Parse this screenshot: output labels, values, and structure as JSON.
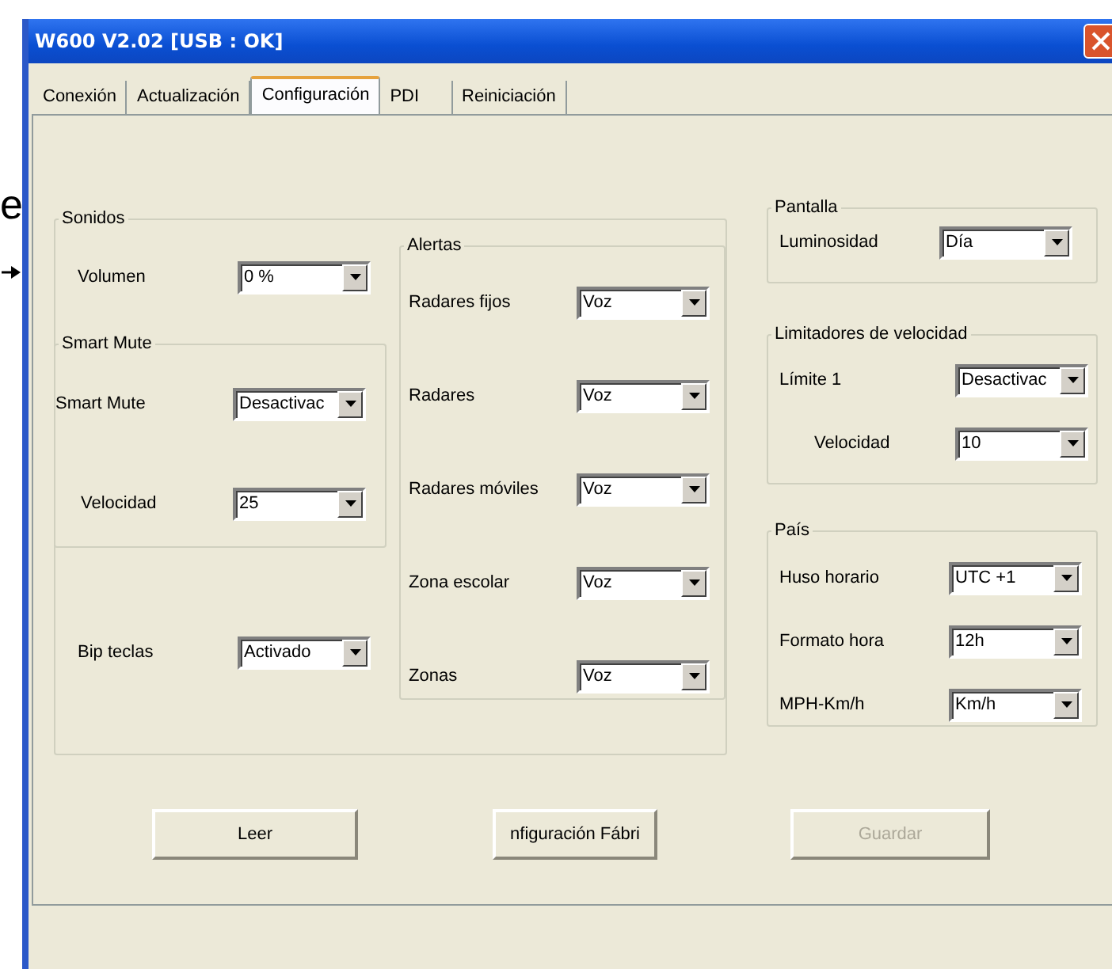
{
  "backdrop": {
    "text": "e"
  },
  "window": {
    "title": "W600 V2.02 [USB : OK]"
  },
  "tabs": [
    {
      "label": "Conexión",
      "selected": false
    },
    {
      "label": "Actualización",
      "selected": false
    },
    {
      "label": "Configuración",
      "selected": true
    },
    {
      "label": "PDI",
      "selected": false
    },
    {
      "label": "Reiniciación",
      "selected": false
    }
  ],
  "sonidos": {
    "title": "Sonidos",
    "volumen": {
      "label": "Volumen",
      "value": "0 %"
    },
    "smart_mute": {
      "title": "Smart Mute",
      "rows": [
        {
          "label": "Smart Mute",
          "value": "Desactivac",
          "indented": false
        },
        {
          "label": "Velocidad",
          "value": "25",
          "indented": true
        }
      ]
    },
    "bip": {
      "label": "Bip teclas",
      "value": "Activado"
    },
    "alertas": {
      "title": "Alertas",
      "rows": [
        {
          "label": "Radares fijos",
          "value": "Voz"
        },
        {
          "label": "Radares",
          "value": "Voz"
        },
        {
          "label": "Radares móviles",
          "value": "Voz"
        },
        {
          "label": "Zona escolar",
          "value": "Voz"
        },
        {
          "label": "Zonas",
          "value": "Voz"
        }
      ]
    }
  },
  "pantalla": {
    "title": "Pantalla",
    "rows": [
      {
        "label": "Luminosidad",
        "value": "Día"
      }
    ]
  },
  "limitadores": {
    "title": "Limitadores de velocidad",
    "rows": [
      {
        "label": "Límite 1",
        "value": "Desactivac",
        "indented": false
      },
      {
        "label": "Velocidad",
        "value": "10",
        "indented": true
      }
    ]
  },
  "pais": {
    "title": "País",
    "rows": [
      {
        "label": "Huso horario",
        "value": "UTC +1"
      },
      {
        "label": "Formato hora",
        "value": "12h"
      },
      {
        "label": "MPH-Km/h",
        "value": "Km/h"
      }
    ]
  },
  "buttons": [
    {
      "label": "Leer",
      "disabled": false
    },
    {
      "label": "nfiguración Fábri",
      "disabled": false
    },
    {
      "label": "Guardar",
      "disabled": true
    }
  ]
}
